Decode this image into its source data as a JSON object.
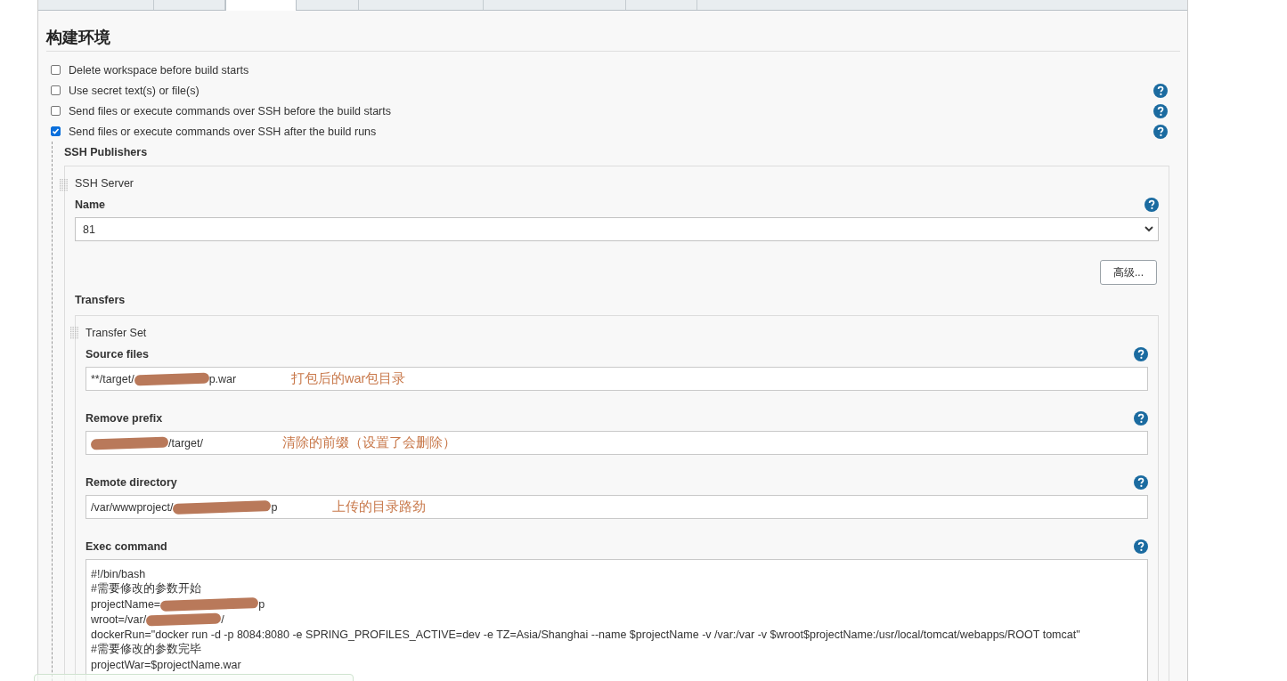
{
  "tabs": [
    {
      "selected": false
    },
    {
      "selected": false
    },
    {
      "selected": true
    },
    {
      "selected": false
    },
    {
      "selected": false
    },
    {
      "selected": false
    },
    {
      "selected": false
    }
  ],
  "section": {
    "title": "构建环境"
  },
  "checkboxes": [
    {
      "label": "Delete workspace before build starts",
      "checked": false,
      "help": false
    },
    {
      "label": "Use secret text(s) or file(s)",
      "checked": false,
      "help": true
    },
    {
      "label": "Send files or execute commands over SSH before the build starts",
      "checked": false,
      "help": true
    },
    {
      "label": "Send files or execute commands over SSH after the build runs",
      "checked": true,
      "help": true
    }
  ],
  "ssh_publishers": {
    "title": "SSH Publishers",
    "server_title": "SSH Server",
    "name_label": "Name",
    "name_value": "81",
    "advanced_button": "高级...",
    "transfers_label": "Transfers",
    "transfer_set_title": "Transfer Set",
    "fields": [
      {
        "label": "Source files",
        "parts": [
          {
            "kind": "text",
            "text": "**/target/"
          },
          {
            "kind": "redaction"
          },
          {
            "kind": "text",
            "text": "p.war"
          }
        ],
        "annotation": "打包后的war包目录"
      },
      {
        "label": "Remove prefix",
        "parts": [
          {
            "kind": "redaction"
          },
          {
            "kind": "text",
            "text": "/target/"
          }
        ],
        "annotation": "清除的前缀（设置了会删除）"
      },
      {
        "label": "Remote directory",
        "parts": [
          {
            "kind": "text",
            "text": "/var/wwwproject/"
          },
          {
            "kind": "redaction"
          },
          {
            "kind": "text",
            "text": "p"
          }
        ],
        "annotation": "上传的目录路劲"
      }
    ],
    "exec_label": "Exec command",
    "exec_lines": [
      [
        {
          "kind": "text",
          "text": "#!/bin/bash"
        }
      ],
      [
        {
          "kind": "text",
          "text": "#需要修改的参数开始"
        }
      ],
      [
        {
          "kind": "text",
          "text": "projectName="
        },
        {
          "kind": "redaction"
        },
        {
          "kind": "text",
          "text": "p"
        }
      ],
      [
        {
          "kind": "text",
          "text": "wroot=/var/"
        },
        {
          "kind": "redaction"
        },
        {
          "kind": "text",
          "text": "/"
        }
      ],
      [
        {
          "kind": "text",
          "text": "dockerRun=\"docker run -d -p 8084:8080 -e SPRING_PROFILES_ACTIVE=dev -e TZ=Asia/Shanghai --name $projectName -v /var:/var -v $wroot$projectName:/usr/local/tomcat/webapps/ROOT tomcat\""
        }
      ],
      [
        {
          "kind": "text",
          "text": "#需要修改的参数完毕"
        }
      ],
      [
        {
          "kind": "text",
          "text": "projectWar=$projectName.war"
        }
      ]
    ]
  }
}
